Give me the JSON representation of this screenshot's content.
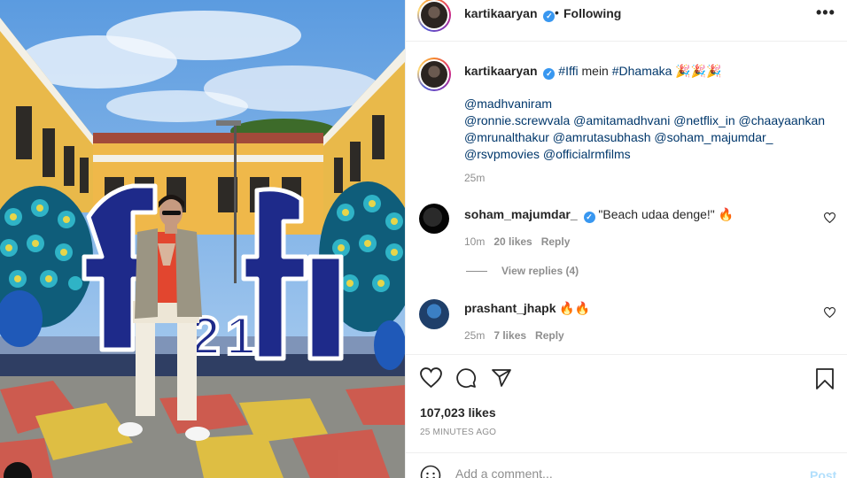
{
  "post": {
    "author": "kartikaaryan",
    "verified_mark": "✓",
    "separator": "•",
    "follow_status": "Following",
    "more_icon": "more-horizontal-icon",
    "more_glyph": "•••"
  },
  "caption": {
    "username": "kartikaaryan",
    "text_before": "",
    "hashtag1": "#Iffi",
    "text_mid": " mein ",
    "hashtag2": "#Dhamaka",
    "emojis": " 🎉🎉🎉",
    "line2": "@madhvaniram",
    "line3": "@ronnie.screwvala @amitamadhvani @netflix_in @chaayaankan",
    "line4": "@mrunalthakur @amrutasubhash @soham_majumdar_",
    "line5": "@rsvpmovies @officialrmfilms",
    "time": "25m"
  },
  "comments": [
    {
      "username": "soham_majumdar_",
      "verified": true,
      "text": "\"Beach udaa denge!\" 🔥",
      "time": "10m",
      "likes": "20 likes",
      "reply": "Reply"
    },
    {
      "username": "prashant_jhapk",
      "verified": false,
      "text": "🔥🔥",
      "time": "25m",
      "likes": "7 likes",
      "reply": "Reply"
    }
  ],
  "view_replies": "View replies (4)",
  "likes_count": "107,023 likes",
  "posted_ago": "25 MINUTES AGO",
  "add_comment": {
    "placeholder": "Add a comment...",
    "post_label": "Post"
  },
  "colors": {
    "link": "#00376b",
    "verified": "#3897f0",
    "muted": "#8e8e8e",
    "post_disabled": "#b2dffc"
  }
}
